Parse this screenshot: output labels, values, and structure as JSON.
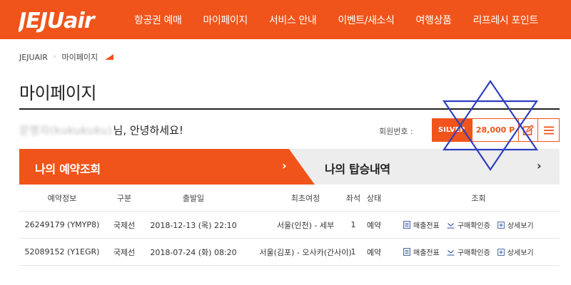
{
  "header": {
    "logo_text": "JEJUair",
    "nav": [
      "항공권 예매",
      "마이페이지",
      "서비스 안내",
      "이벤트/새소식",
      "여행상품",
      "리프레시 포인트"
    ]
  },
  "breadcrumb": [
    "JEJUAIR",
    "마이페이지"
  ],
  "page_title": "마이페이지",
  "greeting": {
    "name_masked": "문명자(kukukuku)",
    "suffix": "님, 안녕하세요!"
  },
  "member": {
    "label": "회원번호 :",
    "grade": "SILVER",
    "points": "28,000 P"
  },
  "tabs": {
    "reservation": "나의 예약조회",
    "boarding": "나의 탑승내역",
    "chevron": "›"
  },
  "table": {
    "headers": [
      "예약정보",
      "구분",
      "출발일",
      "최초여정",
      "좌석",
      "상태",
      "조회"
    ],
    "rows": [
      {
        "booking": "26249179 (YMYP8)",
        "type": "국제선",
        "date": "2018-12-13 (목) 22:10",
        "route": "서울(인천) - 세부",
        "seats": "1",
        "status": "예약"
      },
      {
        "booking": "52089152 (Y1EGR)",
        "type": "국제선",
        "date": "2018-07-24 (화) 08:20",
        "route": "서울(김포) - 오사카(간사이)",
        "seats": "1",
        "status": "예약"
      }
    ],
    "actions": [
      "매출전표",
      "구매확인증",
      "상세보기"
    ]
  },
  "colors": {
    "brand": "#f0541a",
    "tab_gray": "#ededed",
    "overlay_star": "#2f3fbf"
  }
}
